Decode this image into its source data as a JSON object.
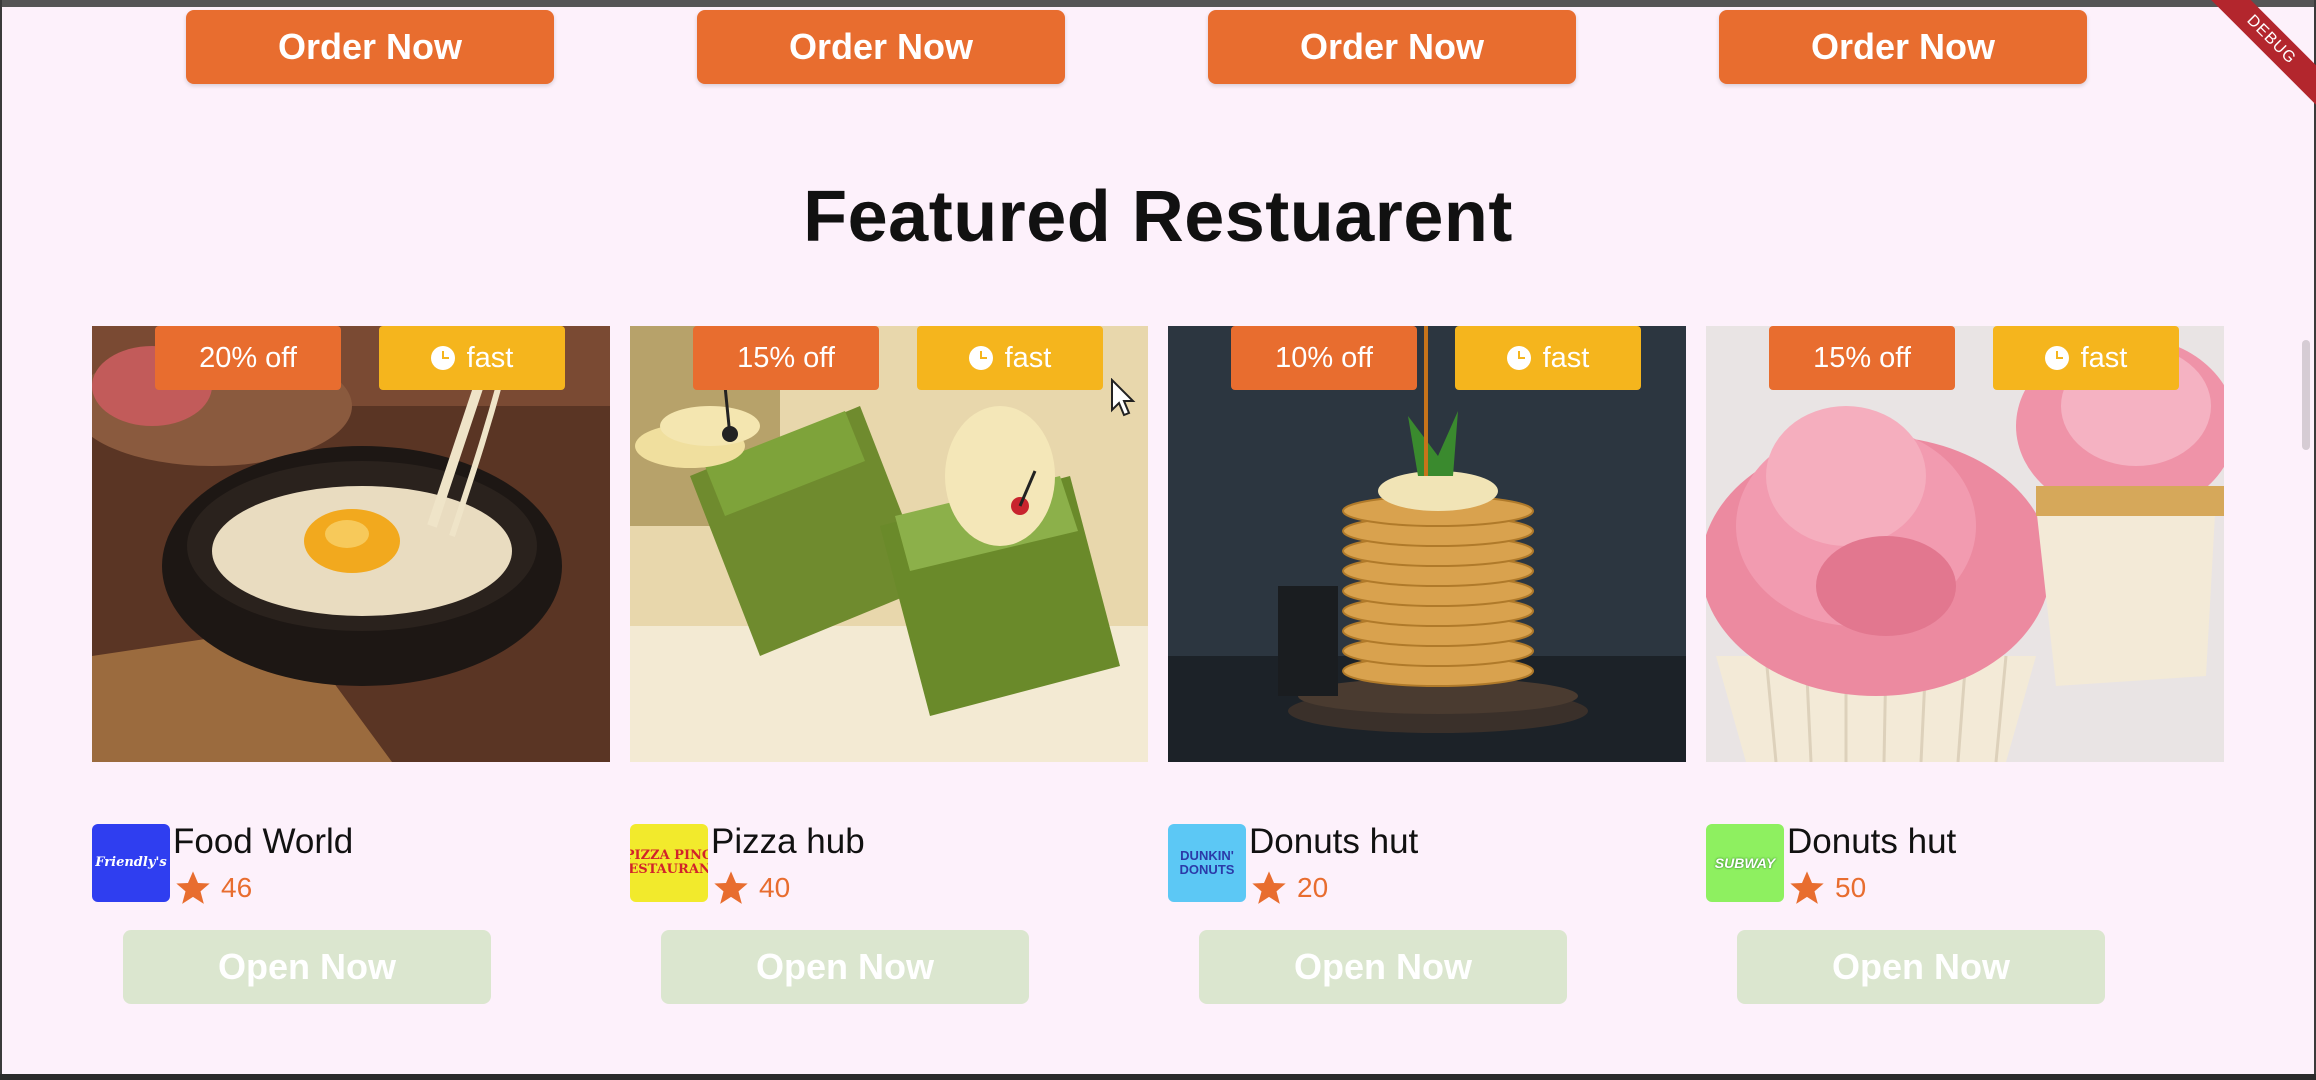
{
  "order_buttons": [
    {
      "label": "Order Now"
    },
    {
      "label": "Order Now"
    },
    {
      "label": "Order Now"
    },
    {
      "label": "Order Now"
    }
  ],
  "section_title": "Featured Restuarent",
  "debug_label": "DEBUG",
  "restaurants": [
    {
      "discount": "20% off",
      "speed": "fast",
      "name": "Food World",
      "rating": "46",
      "logo_text": "Friendly's",
      "open_label": "Open Now",
      "logo_color": "#2f3ef0"
    },
    {
      "discount": "15% off",
      "speed": "fast",
      "name": "Pizza hub",
      "rating": "40",
      "logo_text": "PIZZA PINO RESTAURANT",
      "open_label": "Open Now",
      "logo_color": "#f2ea2c"
    },
    {
      "discount": "10% off",
      "speed": "fast",
      "name": "Donuts hut",
      "rating": "20",
      "logo_text": "DUNKIN' DONUTS",
      "open_label": "Open Now",
      "logo_color": "#5cc8f5"
    },
    {
      "discount": "15% off",
      "speed": "fast",
      "name": "Donuts hut",
      "rating": "50",
      "logo_text": "SUBWAY",
      "open_label": "Open Now",
      "logo_color": "#8ef060"
    }
  ],
  "colors": {
    "accent": "#e86d2f",
    "fast_badge": "#f5b51d",
    "open_button": "#dbe6cf",
    "background": "#fdf1fb"
  },
  "icons": {
    "rating": "star-icon",
    "speed": "clock-icon"
  }
}
